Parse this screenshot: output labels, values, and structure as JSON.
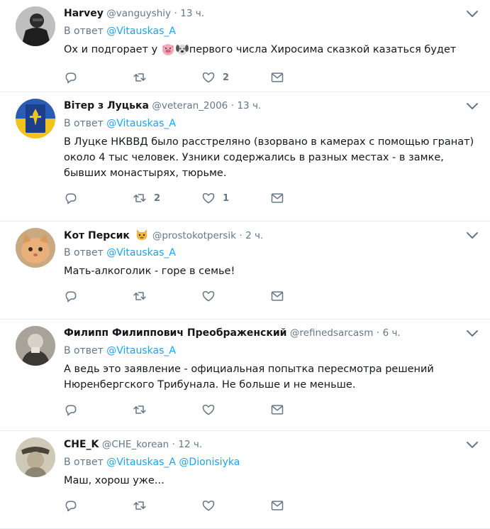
{
  "reply_prefix": "В ответ",
  "icons": [
    "reply-icon",
    "retweet-icon",
    "like-icon",
    "dm-icon",
    "chevron-down-icon"
  ],
  "tweets": [
    {
      "name": "Harvey",
      "handle": "@vanguyshiy",
      "sep": "·",
      "time": "13 ч.",
      "reply_to": [
        "@Vitauskas_A"
      ],
      "text_before": "Ох и подгорает у ",
      "text_after": "первого числа Хиросима сказкой казаться будет",
      "reply_count": "",
      "retweet_count": "",
      "like_count": "2"
    },
    {
      "name": "Вітер з Луцька",
      "handle": "@veteran_2006",
      "sep": "·",
      "time": "13 ч.",
      "reply_to": [
        "@Vitauskas_A"
      ],
      "text": "В Луцке НКВВД было расстреляно (взорвано в камерах с помощью гранат) около 4 тыс человек. Узники содержались в разных местах - в замке, бывших монастырях, тюрьме.",
      "reply_count": "",
      "retweet_count": "2",
      "like_count": "1"
    },
    {
      "name": "Кот Персик",
      "handle": "@prostokotpersik",
      "sep": "·",
      "time": "2 ч.",
      "reply_to": [
        "@Vitauskas_A"
      ],
      "text": "Мать-алкоголик - горе в семье!",
      "reply_count": "",
      "retweet_count": "",
      "like_count": ""
    },
    {
      "name": "Филипп Филиппович Преображенский",
      "handle": "@refinedsarcasm",
      "sep": "·",
      "time": "6 ч.",
      "reply_to": [
        "@Vitauskas_A"
      ],
      "text": "А ведь это заявление - официальная попытка пересмотра решений Нюренбергского Трибунала. Не больше и не меньше.",
      "reply_count": "",
      "retweet_count": "",
      "like_count": ""
    },
    {
      "name": "CHE_K",
      "handle": "@CHE_korean",
      "sep": "·",
      "time": "12 ч.",
      "reply_to": [
        "@Vitauskas_A",
        "@Dionisiyka"
      ],
      "text": "Маш, хорош уже...",
      "reply_count": "",
      "retweet_count": "",
      "like_count": ""
    }
  ]
}
